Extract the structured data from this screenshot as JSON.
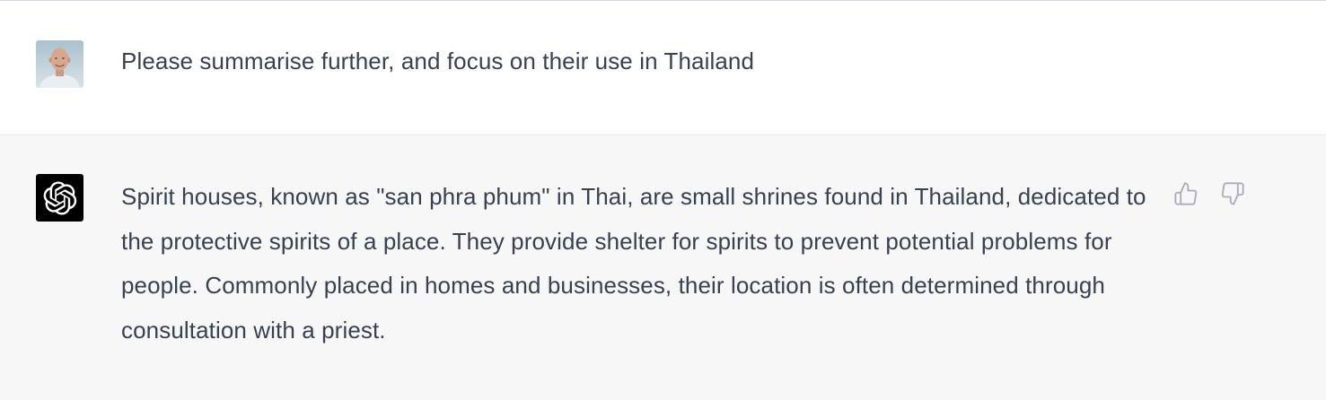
{
  "conversation": {
    "user_message": {
      "avatar_icon": "user-photo-avatar",
      "text": "Please summarise further, and focus on their use in Thailand"
    },
    "assistant_message": {
      "avatar_icon": "openai-logo-icon",
      "avatar_bg": "#000000",
      "text": "Spirit houses, known as \"san phra phum\" in Thai, are small shrines found in Thailand, dedicated to the protective spirits of a place. They provide shelter for spirits to prevent potential problems for people. Commonly placed in homes and businesses, their location is often determined through consultation with a priest.",
      "feedback": {
        "thumbs_up_icon": "thumbs-up-icon",
        "thumbs_down_icon": "thumbs-down-icon"
      }
    }
  },
  "colors": {
    "text": "#374151",
    "assistant_bg": "#f7f7f8",
    "user_bg": "#ffffff",
    "icon_gray": "#acacbe"
  }
}
